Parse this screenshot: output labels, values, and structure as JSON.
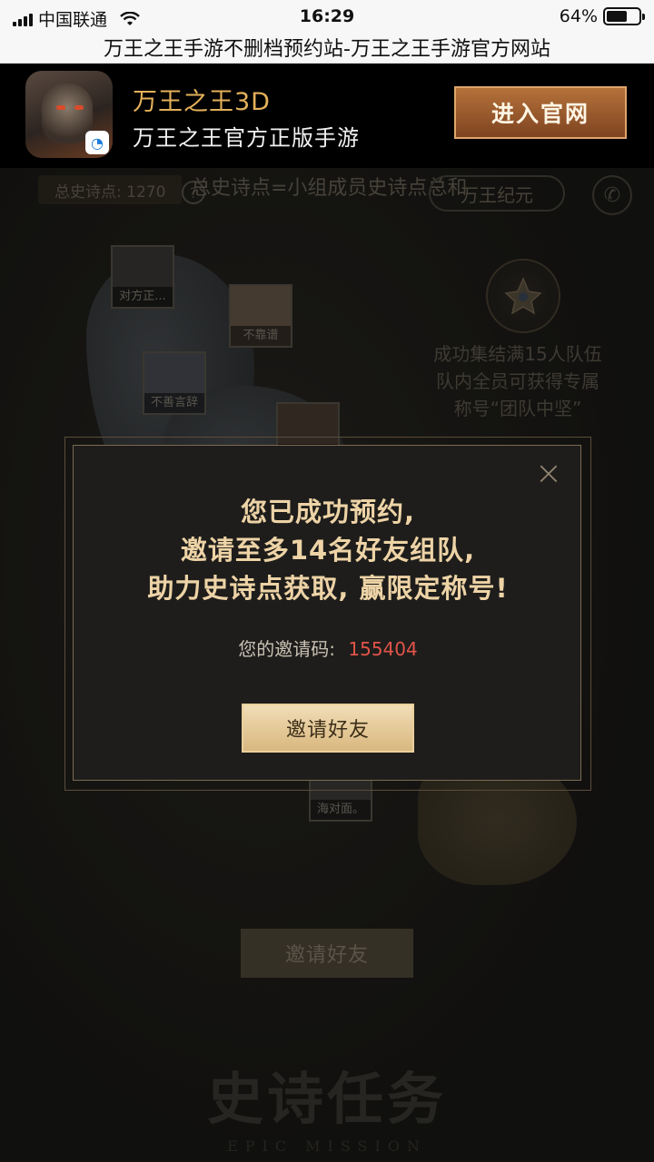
{
  "status_bar": {
    "carrier": "中国联通",
    "time": "16:29",
    "battery": "64%",
    "battery_level": 0.64
  },
  "browser": {
    "title": "万王之王手游不删档预约站-万王之王手游官方网站"
  },
  "app_banner": {
    "app_name": "万王之王3D",
    "subtitle": "万王之王官方正版手游",
    "enter_button": "进入官网"
  },
  "page": {
    "epic_total": "总史诗点: 1270",
    "epic_hint": "总史诗点=小组成员史诗点总和",
    "era_button": "万王纪元",
    "avatars": [
      {
        "label": "对方正..."
      },
      {
        "label": "不靠谱"
      },
      {
        "label": "不善言辞"
      },
      {
        "label": ""
      },
      {
        "label": "海对面。"
      }
    ],
    "reward_text": [
      "成功集结满15人队伍",
      "队内全员可获得专属",
      "称号“团队中坚”"
    ],
    "invite_button": "邀请好友",
    "footer_title": "史诗任务",
    "footer_sub": "EPIC MISSION"
  },
  "modal": {
    "lines": [
      "您已成功预约,",
      "邀请至多14名好友组队,",
      "助力史诗点获取, 赢限定称号!"
    ],
    "code_label": "您的邀请码:",
    "code_value": "155404",
    "invite_button": "邀请好友",
    "close_symbol": "×"
  }
}
